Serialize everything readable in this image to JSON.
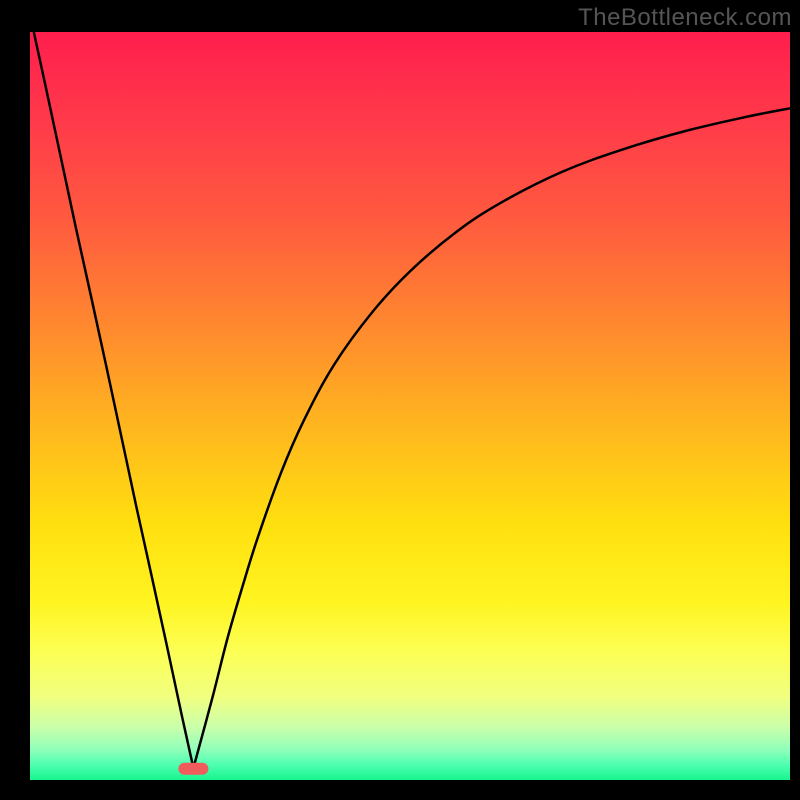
{
  "watermark": "TheBottleneck.com",
  "chart_data": {
    "type": "line",
    "title": "",
    "xlabel": "",
    "ylabel": "",
    "xlim": [
      0,
      100
    ],
    "ylim": [
      0,
      100
    ],
    "grid": false,
    "legend": false,
    "annotations": {
      "marker": {
        "x": 21.5,
        "y": 1.5,
        "color": "#f05c5c"
      }
    },
    "background_gradient": {
      "stops": [
        {
          "offset": 0.0,
          "color": "#ff1e4d"
        },
        {
          "offset": 0.12,
          "color": "#ff3a4a"
        },
        {
          "offset": 0.25,
          "color": "#ff5a3f"
        },
        {
          "offset": 0.38,
          "color": "#ff8430"
        },
        {
          "offset": 0.52,
          "color": "#ffb41f"
        },
        {
          "offset": 0.66,
          "color": "#ffe00f"
        },
        {
          "offset": 0.76,
          "color": "#fff420"
        },
        {
          "offset": 0.83,
          "color": "#fcff55"
        },
        {
          "offset": 0.89,
          "color": "#f0ff80"
        },
        {
          "offset": 0.93,
          "color": "#c9ffab"
        },
        {
          "offset": 0.96,
          "color": "#8effba"
        },
        {
          "offset": 0.98,
          "color": "#4dffb0"
        },
        {
          "offset": 1.0,
          "color": "#17f58e"
        }
      ]
    },
    "series": [
      {
        "name": "left-descent",
        "x": [
          0.5,
          2,
          4,
          6,
          8,
          10,
          12,
          14,
          16,
          18,
          20,
          21.5
        ],
        "values": [
          100,
          93,
          83.5,
          74,
          64.8,
          55.5,
          46,
          36.5,
          27.3,
          18,
          8.5,
          1.6
        ]
      },
      {
        "name": "right-arc",
        "x": [
          21.5,
          24,
          26,
          28,
          30,
          33,
          36,
          40,
          45,
          50,
          56,
          62,
          70,
          78,
          86,
          94,
          100
        ],
        "values": [
          1.6,
          11,
          19,
          26,
          32.5,
          41,
          48,
          55.5,
          62.5,
          68,
          73.2,
          77.2,
          81.3,
          84.3,
          86.7,
          88.6,
          89.8
        ]
      }
    ]
  }
}
